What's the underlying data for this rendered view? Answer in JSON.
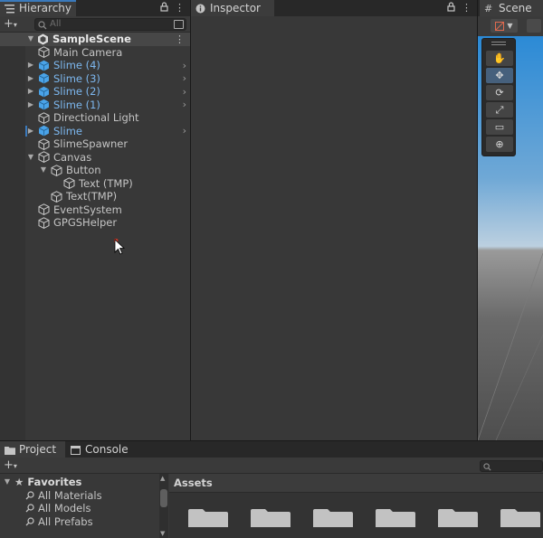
{
  "hierarchy": {
    "tab_label": "Hierarchy",
    "search_placeholder": "All",
    "scene_name": "SampleScene",
    "items": [
      {
        "label": "Main Camera",
        "depth": 1,
        "prefab": false,
        "expand": "",
        "chevron": false
      },
      {
        "label": "Slime (4)",
        "depth": 1,
        "prefab": true,
        "expand": "collapsed",
        "chevron": true
      },
      {
        "label": "Slime (3)",
        "depth": 1,
        "prefab": true,
        "expand": "collapsed",
        "chevron": true
      },
      {
        "label": "Slime (2)",
        "depth": 1,
        "prefab": true,
        "expand": "collapsed",
        "chevron": true
      },
      {
        "label": "Slime (1)",
        "depth": 1,
        "prefab": true,
        "expand": "collapsed",
        "chevron": true
      },
      {
        "label": "Directional Light",
        "depth": 1,
        "prefab": false,
        "expand": "",
        "chevron": false
      },
      {
        "label": "Slime",
        "depth": 1,
        "prefab": true,
        "expand": "collapsed",
        "chevron": true
      },
      {
        "label": "SlimeSpawner",
        "depth": 1,
        "prefab": false,
        "expand": "",
        "chevron": false
      },
      {
        "label": "Canvas",
        "depth": 1,
        "prefab": false,
        "expand": "expanded",
        "chevron": false
      },
      {
        "label": "Button",
        "depth": 2,
        "prefab": false,
        "expand": "expanded",
        "chevron": false
      },
      {
        "label": "Text (TMP)",
        "depth": 3,
        "prefab": false,
        "expand": "",
        "chevron": false
      },
      {
        "label": "Text(TMP)",
        "depth": 2,
        "prefab": false,
        "expand": "",
        "chevron": false
      },
      {
        "label": "EventSystem",
        "depth": 1,
        "prefab": false,
        "expand": "",
        "chevron": false
      },
      {
        "label": "GPGSHelper",
        "depth": 1,
        "prefab": false,
        "expand": "",
        "chevron": false
      }
    ]
  },
  "inspector": {
    "tab_label": "Inspector"
  },
  "scene": {
    "tab_label": "Scene",
    "tools": [
      "hand-tool",
      "move-tool",
      "rotate-tool",
      "scale-tool",
      "rect-tool",
      "transform-tool"
    ],
    "active_tool": "move-tool"
  },
  "project": {
    "tab_project": "Project",
    "tab_console": "Console",
    "favorites_label": "Favorites",
    "favorites": [
      "All Materials",
      "All Models",
      "All Prefabs"
    ],
    "assets_label": "Assets",
    "folder_count": 6
  },
  "colors": {
    "accent": "#3a79bb",
    "prefab_text": "#7db8f0",
    "panel_bg": "#383838"
  }
}
